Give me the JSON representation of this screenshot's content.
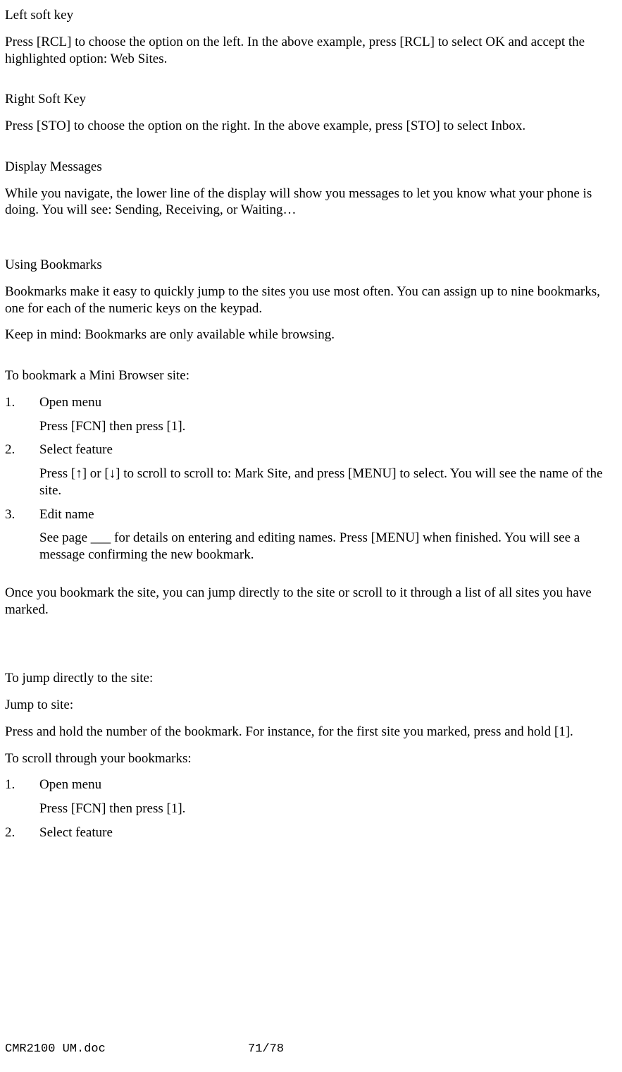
{
  "sections": {
    "leftSoftKey": {
      "title": "Left soft key",
      "body": "Press [RCL] to choose the option on the left. In the above example, press [RCL] to select OK and accept the highlighted option: Web Sites."
    },
    "rightSoftKey": {
      "title": "Right Soft Key",
      "body": "Press [STO] to choose the option on the right. In the above example, press [STO] to select Inbox."
    },
    "displayMessages": {
      "title": "Display Messages",
      "body": "While you navigate, the lower line of the display will show you messages to let you know what your phone is doing. You will see: Sending, Receiving, or Waiting…"
    },
    "usingBookmarks": {
      "title": "Using Bookmarks",
      "body1": "Bookmarks make it easy to quickly jump to the sites you use most often. You can assign up to nine bookmarks, one for each of the numeric keys on the keypad.",
      "body2": "Keep in mind:  Bookmarks are only available while browsing."
    },
    "toBookmark": {
      "title": "To bookmark a Mini Browser site:",
      "steps": [
        {
          "num": "1.",
          "title": "Open menu",
          "body": "Press [FCN] then press [1]."
        },
        {
          "num": "2.",
          "title": "Select feature",
          "body": "Press [↑] or [↓] to scroll to scroll to: Mark Site, and press [MENU] to select. You will see the name of the site."
        },
        {
          "num": "3.",
          "title": "Edit name",
          "body": "See page ___ for details on entering and editing names. Press [MENU] when finished. You will see a message confirming the new bookmark."
        }
      ],
      "after": "Once you bookmark the site, you can jump directly to the site or scroll to it through a list of all sites you have marked."
    },
    "toJump": {
      "title": "To jump directly to the site:",
      "sub": "Jump to site:",
      "body": "Press and hold the number of the bookmark. For instance, for the first site you marked, press and hold [1].",
      "scrollTitle": "To scroll through your bookmarks:",
      "steps": [
        {
          "num": "1.",
          "title": "Open menu",
          "body": "Press [FCN] then press [1]."
        },
        {
          "num": "2.",
          "title": "Select feature",
          "body": ""
        }
      ]
    }
  },
  "footer": {
    "left": "CMR2100 UM.doc",
    "center": "71/78"
  }
}
